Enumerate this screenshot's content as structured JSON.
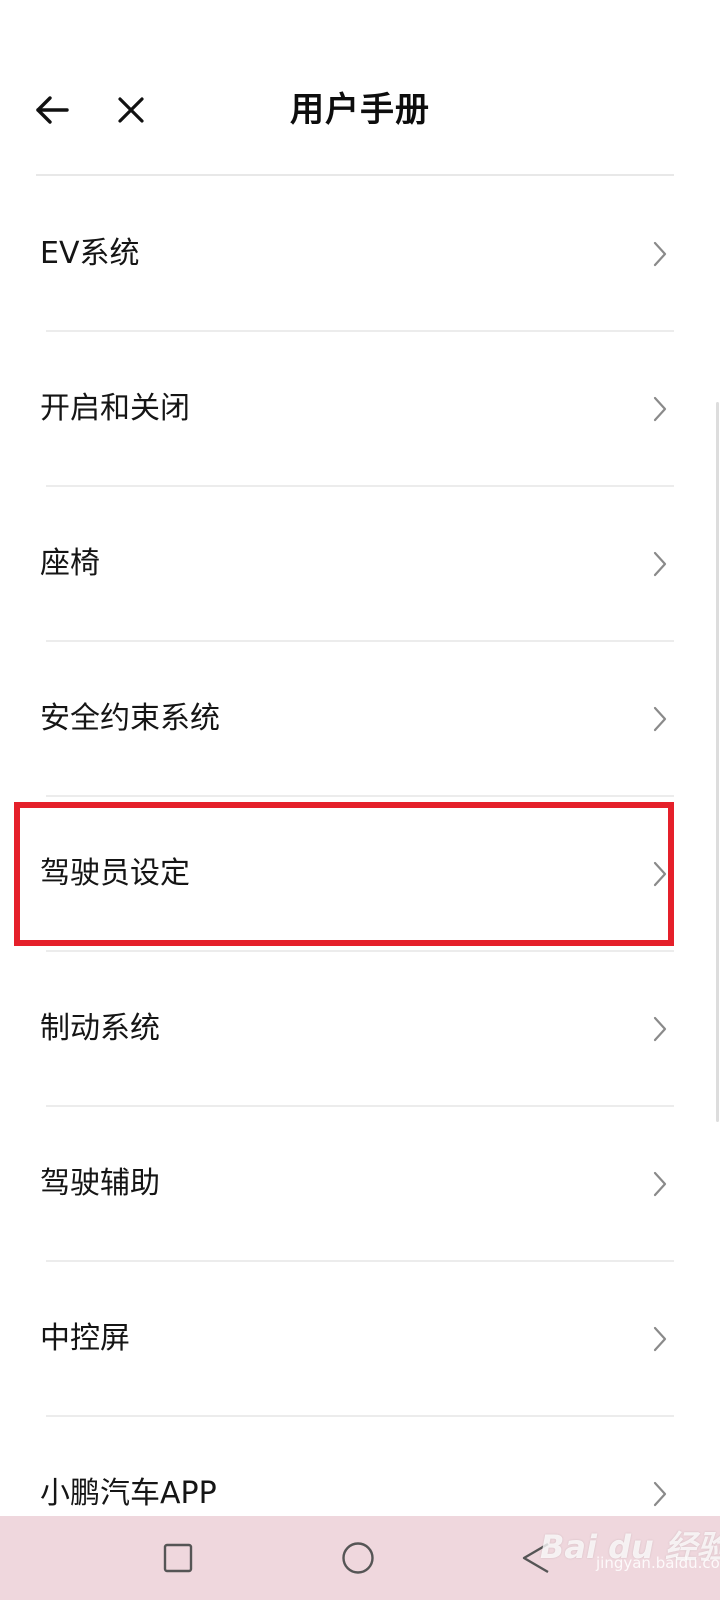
{
  "header": {
    "title": "用户手册",
    "back_icon": "arrow-left-icon",
    "close_icon": "close-icon"
  },
  "menu": {
    "items": [
      {
        "label": "EV系统"
      },
      {
        "label": "开启和关闭"
      },
      {
        "label": "座椅"
      },
      {
        "label": "安全约束系统"
      },
      {
        "label": "驾驶员设定"
      },
      {
        "label": "制动系统"
      },
      {
        "label": "驾驶辅助"
      },
      {
        "label": "中控屏"
      },
      {
        "label": "小鹏汽车APP"
      }
    ],
    "chevron_icon": "chevron-right-icon",
    "highlighted_item": "驾驶员设定",
    "highlight_color": "#e5202a"
  },
  "system_nav": {
    "recent_icon": "square-icon",
    "home_icon": "circle-icon",
    "back_icon": "triangle-back-icon",
    "background_color": "#efd7dd"
  },
  "watermark": {
    "main": "Bai du 经验",
    "sub": "jingyan.baidu.com"
  }
}
